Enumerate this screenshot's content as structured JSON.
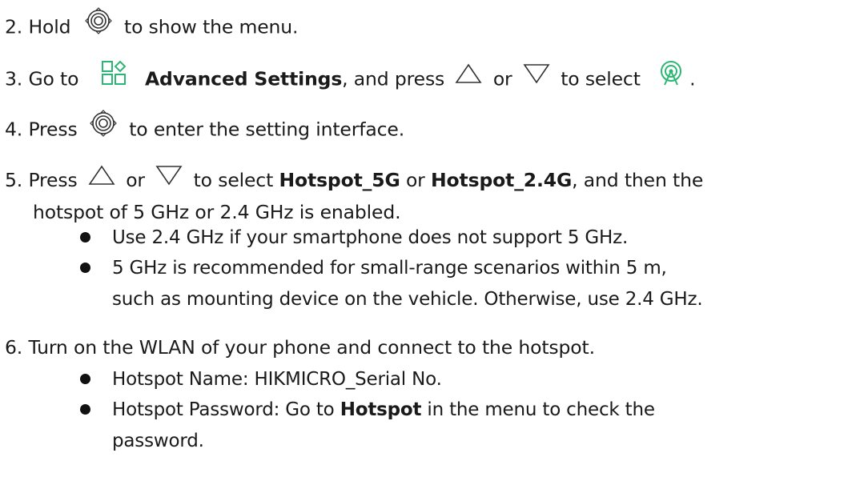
{
  "steps": {
    "s2": {
      "num": "2. Hold",
      "text": "to show the menu."
    },
    "s3": {
      "num": "3. Go to",
      "bold1": "Advanced Settings",
      "text1": ", and press",
      "or": "or",
      "text2": "to select",
      "end": "."
    },
    "s4": {
      "num": "4. Press",
      "text": "to enter the setting interface."
    },
    "s5": {
      "num": "5. Press",
      "or": "or",
      "text1": "to select",
      "bold1": "Hotspot_5G",
      "or2": "or",
      "bold2": "Hotspot_2.4G",
      "text2": ", and then the",
      "line2": "hotspot of 5 GHz or 2.4 GHz is enabled.",
      "bullets": [
        {
          "line1": "Use 2.4 GHz if your smartphone does not support 5 GHz."
        },
        {
          "line1": "5 GHz is recommended for small-range scenarios within 5 m,",
          "line2": "such as mounting device on the vehicle. Otherwise, use 2.4 GHz."
        }
      ]
    },
    "s6": {
      "line1": "6. Turn on the WLAN of your phone and connect to the hotspot.",
      "bullets": [
        {
          "line1": "Hotspot Name: HIKMICRO_Serial No."
        },
        {
          "pre": "Hotspot Password: Go to",
          "bold": "Hotspot",
          "post": "in the menu to check the",
          "line2": "password."
        }
      ]
    }
  },
  "icons": {
    "ok": "ok-button-icon",
    "advanced": "advanced-settings-icon",
    "up": "up-triangle-icon",
    "down": "down-triangle-icon",
    "hotspot": "hotspot-icon",
    "accent": "#2bb673"
  }
}
